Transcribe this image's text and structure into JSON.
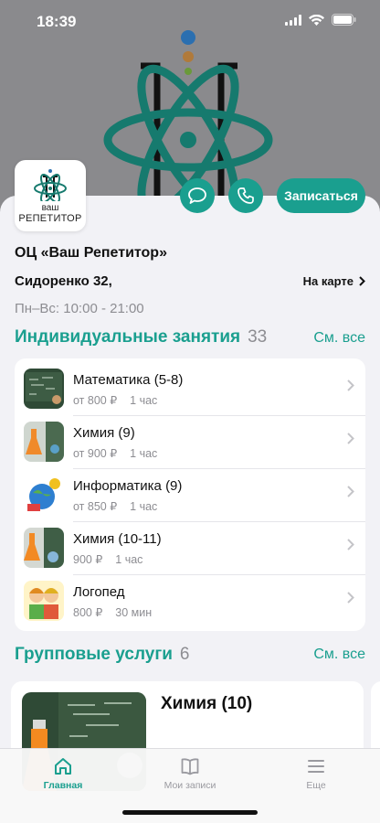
{
  "status_bar": {
    "time": "18:39"
  },
  "colors": {
    "accent": "#1a9f8f",
    "hero_bg": "#8a8a8d",
    "muted": "#8d8d92"
  },
  "logo": {
    "line1": "ваш",
    "line2": "РЕПЕТИТОР"
  },
  "actions": {
    "chat_icon": "chat-bubble-icon",
    "phone_icon": "phone-icon",
    "signup_label": "Записаться"
  },
  "org": {
    "name": "ОЦ «Ваш Репетитор»",
    "address": "Сидоренко 32,",
    "map_link": "На карте",
    "hours": "Пн–Вс: 10:00 - 21:00"
  },
  "individual": {
    "title": "Индивидуальные занятия",
    "count": "33",
    "see_all": "См. все",
    "items": [
      {
        "title": "Математика (5-8)",
        "price": "от 800 ₽",
        "duration": "1 час"
      },
      {
        "title": "Химия (9)",
        "price": "от 900 ₽",
        "duration": "1 час"
      },
      {
        "title": "Информатика (9)",
        "price": "от 850 ₽",
        "duration": "1 час"
      },
      {
        "title": "Химия (10-11)",
        "price": "900 ₽",
        "duration": "1 час"
      },
      {
        "title": "Логопед",
        "price": "800 ₽",
        "duration": "30 мин"
      }
    ]
  },
  "group": {
    "title": "Групповые услуги",
    "count": "6",
    "see_all": "См. все",
    "cards": [
      {
        "title": "Химия (10)"
      }
    ]
  },
  "tabbar": {
    "tabs": [
      {
        "label": "Главная",
        "icon": "home-icon",
        "active": true
      },
      {
        "label": "Мои записи",
        "icon": "book-icon",
        "active": false
      },
      {
        "label": "Еще",
        "icon": "menu-icon",
        "active": false
      }
    ]
  }
}
